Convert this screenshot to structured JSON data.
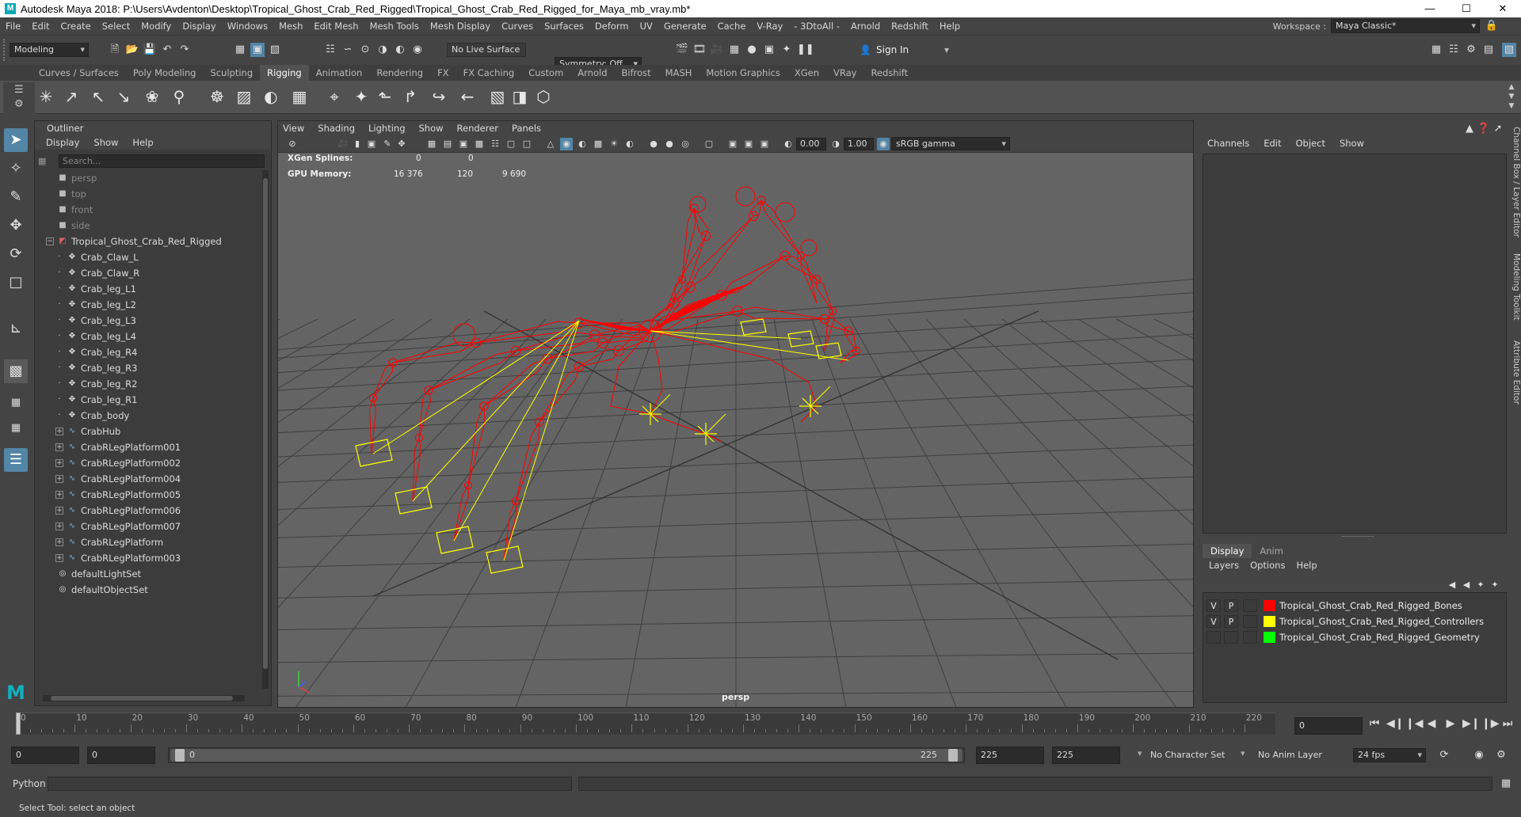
{
  "window": {
    "title": "Autodesk Maya 2018: P:\\Users\\Avdenton\\Desktop\\Tropical_Ghost_Crab_Red_Rigged\\Tropical_Ghost_Crab_Red_Rigged_for_Maya_mb_vray.mb*",
    "minimize": "—",
    "maximize": "☐",
    "close": "✕"
  },
  "menubar": [
    "File",
    "Edit",
    "Create",
    "Select",
    "Modify",
    "Display",
    "Windows",
    "Mesh",
    "Edit Mesh",
    "Mesh Tools",
    "Mesh Display",
    "Curves",
    "Surfaces",
    "Deform",
    "UV",
    "Generate",
    "Cache",
    "V-Ray",
    "- 3DtoAll -",
    "Arnold",
    "Redshift",
    "Help"
  ],
  "workspace": {
    "label": "Workspace :",
    "value": "Maya Classic*"
  },
  "statusline": {
    "mode": "Modeling",
    "live_surface": "No Live Surface",
    "symmetry": "Symmetry: Off",
    "sign_in": "Sign In"
  },
  "shelf_tabs": [
    "Curves / Surfaces",
    "Poly Modeling",
    "Sculpting",
    "Rigging",
    "Animation",
    "Rendering",
    "FX",
    "FX Caching",
    "Custom",
    "Arnold",
    "Bifrost",
    "MASH",
    "Motion Graphics",
    "XGen",
    "VRay",
    "Redshift"
  ],
  "active_shelf_tab": "Rigging",
  "shelf_icons": [
    "joint-tool-icon",
    "ik-handle-icon",
    "ik-spline-icon",
    "insert-joint-icon",
    "quick-rig-icon",
    "human-ik-icon",
    "bind-skin-icon",
    "smooth-bind-icon",
    "paint-weights-icon",
    "lattice-icon",
    "cluster-icon",
    "locator-icon",
    "point-constraint-icon",
    "orient-constraint-icon",
    "parent-constraint-icon",
    "aim-constraint-icon",
    "pole-vector-icon",
    "scale-constraint-icon",
    "curve-warp-icon"
  ],
  "outliner": {
    "title": "Outliner",
    "menu": [
      "Display",
      "Show",
      "Help"
    ],
    "search_placeholder": "Search...",
    "items": [
      {
        "label": "persp",
        "type": "camera",
        "dim": true,
        "indent": 0,
        "expand": ""
      },
      {
        "label": "top",
        "type": "camera",
        "dim": true,
        "indent": 0,
        "expand": ""
      },
      {
        "label": "front",
        "type": "camera",
        "dim": true,
        "indent": 0,
        "expand": ""
      },
      {
        "label": "side",
        "type": "camera",
        "dim": true,
        "indent": 0,
        "expand": ""
      },
      {
        "label": "Tropical_Ghost_Crab_Red_Rigged",
        "type": "group",
        "dim": false,
        "indent": 0,
        "expand": "−"
      },
      {
        "label": "Crab_Claw_L",
        "type": "joint",
        "dim": false,
        "indent": 1,
        "expand": ""
      },
      {
        "label": "Crab_Claw_R",
        "type": "joint",
        "dim": false,
        "indent": 1,
        "expand": ""
      },
      {
        "label": "Crab_leg_L1",
        "type": "joint",
        "dim": false,
        "indent": 1,
        "expand": ""
      },
      {
        "label": "Crab_leg_L2",
        "type": "joint",
        "dim": false,
        "indent": 1,
        "expand": ""
      },
      {
        "label": "Crab_leg_L3",
        "type": "joint",
        "dim": false,
        "indent": 1,
        "expand": ""
      },
      {
        "label": "Crab_leg_L4",
        "type": "joint",
        "dim": false,
        "indent": 1,
        "expand": ""
      },
      {
        "label": "Crab_leg_R4",
        "type": "joint",
        "dim": false,
        "indent": 1,
        "expand": ""
      },
      {
        "label": "Crab_leg_R3",
        "type": "joint",
        "dim": false,
        "indent": 1,
        "expand": ""
      },
      {
        "label": "Crab_leg_R2",
        "type": "joint",
        "dim": false,
        "indent": 1,
        "expand": ""
      },
      {
        "label": "Crab_leg_R1",
        "type": "joint",
        "dim": false,
        "indent": 1,
        "expand": ""
      },
      {
        "label": "Crab_body",
        "type": "joint",
        "dim": false,
        "indent": 1,
        "expand": ""
      },
      {
        "label": "CrabHub",
        "type": "curve",
        "dim": false,
        "indent": 1,
        "expand": "+"
      },
      {
        "label": "CrabRLegPlatform001",
        "type": "curve",
        "dim": false,
        "indent": 1,
        "expand": "+"
      },
      {
        "label": "CrabRLegPlatform002",
        "type": "curve",
        "dim": false,
        "indent": 1,
        "expand": "+"
      },
      {
        "label": "CrabRLegPlatform004",
        "type": "curve",
        "dim": false,
        "indent": 1,
        "expand": "+"
      },
      {
        "label": "CrabRLegPlatform005",
        "type": "curve",
        "dim": false,
        "indent": 1,
        "expand": "+"
      },
      {
        "label": "CrabRLegPlatform006",
        "type": "curve",
        "dim": false,
        "indent": 1,
        "expand": "+"
      },
      {
        "label": "CrabRLegPlatform007",
        "type": "curve",
        "dim": false,
        "indent": 1,
        "expand": "+"
      },
      {
        "label": "CrabRLegPlatform",
        "type": "curve",
        "dim": false,
        "indent": 1,
        "expand": "+"
      },
      {
        "label": "CrabRLegPlatform003",
        "type": "curve",
        "dim": false,
        "indent": 1,
        "expand": "+"
      },
      {
        "label": "defaultLightSet",
        "type": "set",
        "dim": false,
        "indent": 0,
        "expand": ""
      },
      {
        "label": "defaultObjectSet",
        "type": "set",
        "dim": false,
        "indent": 0,
        "expand": ""
      }
    ]
  },
  "viewport": {
    "menu": [
      "View",
      "Shading",
      "Lighting",
      "Show",
      "Renderer",
      "Panels"
    ],
    "exposure": "0.00",
    "gamma": "1.00",
    "color_space": "sRGB gamma",
    "hud": {
      "xgen_label": "XGen Splines:",
      "xgen_v1": "0",
      "xgen_v2": "0",
      "gpu_label": "GPU Memory:",
      "gpu_v1": "16 376",
      "gpu_v2": "120",
      "gpu_v3": "9 690"
    },
    "camera": "persp",
    "colors": {
      "grid": "#3f3f3f",
      "bones": "#ff0000",
      "controllers": "#ffff00",
      "background": "#646464"
    }
  },
  "channel_box": {
    "menu": [
      "Channels",
      "Edit",
      "Object",
      "Show"
    ],
    "side_tabs": [
      "Channel Box / Layer Editor",
      "Modeling Toolkit",
      "Attribute Editor"
    ]
  },
  "layer_editor": {
    "tabs": [
      "Display",
      "Anim"
    ],
    "menu": [
      "Layers",
      "Options",
      "Help"
    ],
    "layers": [
      {
        "v": "V",
        "p": "P",
        "name": "Tropical_Ghost_Crab_Red_Rigged_Bones",
        "color": "#ff0000"
      },
      {
        "v": "V",
        "p": "P",
        "name": "Tropical_Ghost_Crab_Red_Rigged_Controllers",
        "color": "#ffff00"
      },
      {
        "v": "",
        "p": "",
        "name": "Tropical_Ghost_Crab_Red_Rigged_Geometry",
        "color": "#00ff00"
      }
    ]
  },
  "timeslider": {
    "ticks": [
      "0",
      "10",
      "20",
      "30",
      "40",
      "50",
      "60",
      "70",
      "80",
      "90",
      "100",
      "110",
      "120",
      "130",
      "140",
      "150",
      "160",
      "170",
      "180",
      "190",
      "200",
      "210",
      "220"
    ],
    "current_frame": "0"
  },
  "range": {
    "start": "0",
    "anim_start": "0",
    "slider_start": "0",
    "slider_end": "225",
    "end": "225",
    "anim_end": "225",
    "character_set": "No Character Set",
    "anim_layer": "No Anim Layer",
    "fps": "24 fps"
  },
  "cmdline": {
    "label": "Python"
  },
  "helpline": {
    "text": "Select Tool: select an object"
  }
}
